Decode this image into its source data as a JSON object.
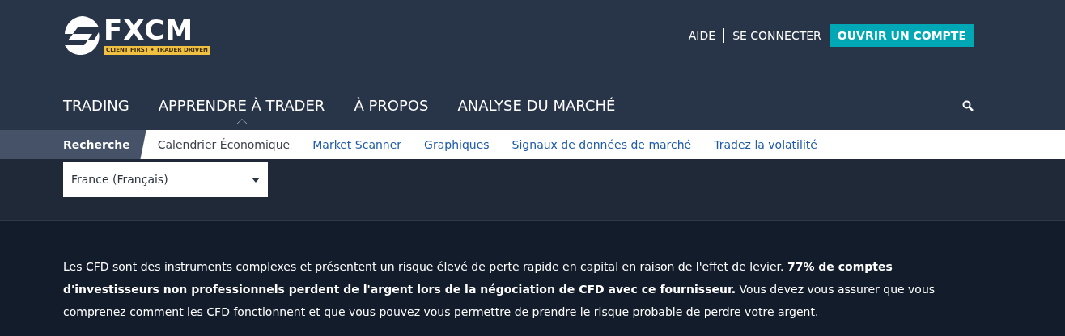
{
  "logo": {
    "name": "FXCM",
    "tagline": "CLIENT FIRST • TRADER DRIVEN"
  },
  "top_links": [
    "AIDE",
    "SE CONNECTER"
  ],
  "cta": "OUVRIR UN COMPTE",
  "main_nav": [
    {
      "label": "TRADING",
      "selected": false
    },
    {
      "label": "APPRENDRE À TRADER",
      "selected": true
    },
    {
      "label": "À PROPOS",
      "selected": false
    },
    {
      "label": "ANALYSE DU MARCHÉ",
      "selected": false
    }
  ],
  "sub_nav": [
    {
      "label": "Recherche",
      "selected": true,
      "kind": "plain"
    },
    {
      "label": "Calendrier Économique",
      "selected": false,
      "kind": "plain"
    },
    {
      "label": "Market Scanner",
      "selected": false,
      "kind": "link"
    },
    {
      "label": "Graphiques",
      "selected": false,
      "kind": "link"
    },
    {
      "label": "Signaux de données de marché",
      "selected": false,
      "kind": "link"
    },
    {
      "label": "Tradez la volatilité",
      "selected": false,
      "kind": "link"
    }
  ],
  "region_select": {
    "value": "France (Français)"
  },
  "disclaimer": "Les CFD sont des instruments complexes et présentent un risque élevé de perte rapide en capital en raison de l'effet de levier. **77% de comptes d'investisseurs non professionnels perdent de l'argent lors de la négociation de CFD avec ce fournisseur.** Vous devez vous assurer que vous comprenez comment les CFD fonctionnent et que vous pouvez vous permettre de prendre le risque probable de perdre votre argent."
}
